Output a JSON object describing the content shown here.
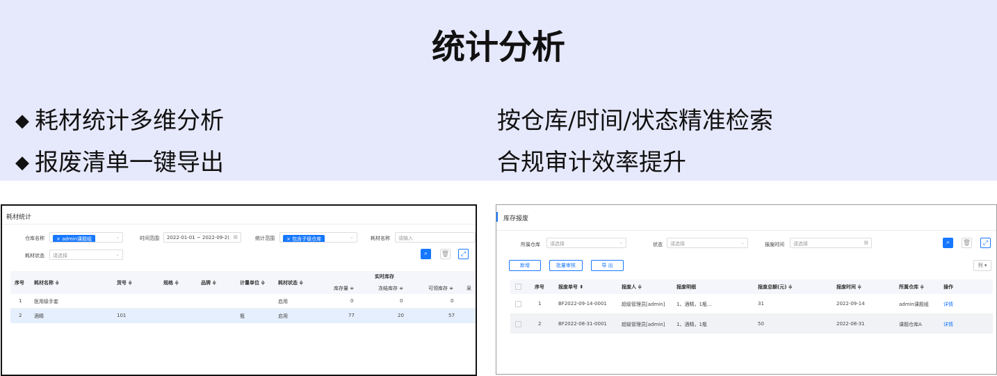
{
  "header": {
    "title": "统计分析",
    "bullet_symbol": "◆",
    "left_points": [
      "耗材统计多维分析",
      "报废清单一键导出"
    ],
    "right_points": [
      "按仓库/时间/状态精准检索",
      "合规审计效率提升"
    ]
  },
  "stats_panel": {
    "title": "耗材统计",
    "filters": {
      "warehouse_label": "仓库名称",
      "warehouse_tag": "× admin课题组",
      "time_label": "时间范围",
      "time_value": "2022-01-01 ~ 2022-09-2(",
      "scope_label": "统计范围",
      "scope_tag": "× 包含子级仓库",
      "name_label": "耗材名称",
      "name_placeholder": "请输入",
      "status_label": "耗材状态",
      "status_placeholder": "请选择"
    },
    "icons": [
      "search-icon",
      "trash-icon",
      "fullscreen-icon"
    ],
    "columns": {
      "index": "序号",
      "name": "耗材名称 ≑",
      "sku": "货号 ≑",
      "spec": "规格 ≑",
      "brand": "品牌 ≑",
      "unit": "计量单位 ≑",
      "state": "耗材状态 ≑",
      "group": "实时库存",
      "stock": "库存量 ≑",
      "frozen": "冻结库存 ≑",
      "available": "可领库存 ≑",
      "extra": "采"
    },
    "rows": [
      {
        "index": "1",
        "name": "医用级手套",
        "sku": "",
        "spec": "",
        "brand": "",
        "unit": "",
        "state": "启用",
        "stock": "0",
        "frozen": "0",
        "available": "0"
      },
      {
        "index": "2",
        "name": "酒精",
        "sku": "101",
        "spec": "",
        "brand": "",
        "unit": "瓶",
        "state": "启用",
        "stock": "77",
        "frozen": "20",
        "available": "57"
      }
    ]
  },
  "scrap_panel": {
    "title": "库存报废",
    "filters": {
      "warehouse_label": "所属仓库",
      "warehouse_placeholder": "请选择",
      "status_label": "状态",
      "status_placeholder": "请选择",
      "time_label": "报废时间",
      "time_placeholder": "请选择"
    },
    "buttons": {
      "add": "新增",
      "batch_review": "批量审核",
      "export": "导 出",
      "columns": "列 ▾"
    },
    "columns": {
      "index": "序号",
      "no": "报废单号 ⬍",
      "person": "报废人 ≑",
      "detail": "报废明细",
      "amount": "报废总额(元) ≑",
      "time": "报废时间 ≑",
      "warehouse": "所属仓库 ≑",
      "action": "操作"
    },
    "rows": [
      {
        "index": "1",
        "no": "BF2022-09-14-0001",
        "person": "超级管理员[admin]",
        "detail": "1、酒精，1瓶...",
        "amount": "31",
        "time": "2022-09-14",
        "warehouse": "admin课题组",
        "action": "详情"
      },
      {
        "index": "2",
        "no": "BF2022-08-31-0001",
        "person": "超级管理员[admin]",
        "detail": "1、酒精，1瓶",
        "amount": "50",
        "time": "2022-08-31",
        "warehouse": "课题仓库A",
        "action": "详情"
      }
    ]
  },
  "colors": {
    "banner": "#e6e8fb",
    "accent": "#1677ff",
    "highlight_row": "#e6effd"
  }
}
